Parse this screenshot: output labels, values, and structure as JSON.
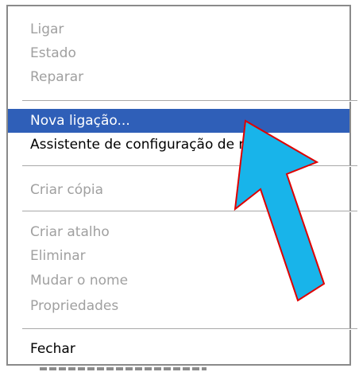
{
  "menu": {
    "items": [
      {
        "label": "Ligar",
        "state": "disabled"
      },
      {
        "label": "Estado",
        "state": "disabled"
      },
      {
        "label": "Reparar",
        "state": "disabled"
      },
      {
        "label": "Nova ligação...",
        "state": "highlighted"
      },
      {
        "label": "Assistente de configuração de rede...",
        "state": "enabled"
      },
      {
        "label": "Criar cópia",
        "state": "disabled"
      },
      {
        "label": "Criar atalho",
        "state": "disabled"
      },
      {
        "label": "Eliminar",
        "state": "disabled"
      },
      {
        "label": "Mudar o nome",
        "state": "disabled"
      },
      {
        "label": "Propriedades",
        "state": "disabled"
      },
      {
        "label": "Fechar",
        "state": "enabled"
      }
    ]
  },
  "colors": {
    "highlight": "#2f5fb8",
    "arrow_fill": "#18b4ea",
    "arrow_stroke": "#e00000",
    "disabled_text": "#a0a0a0"
  },
  "annotation": {
    "icon": "arrow-pointer-icon"
  }
}
